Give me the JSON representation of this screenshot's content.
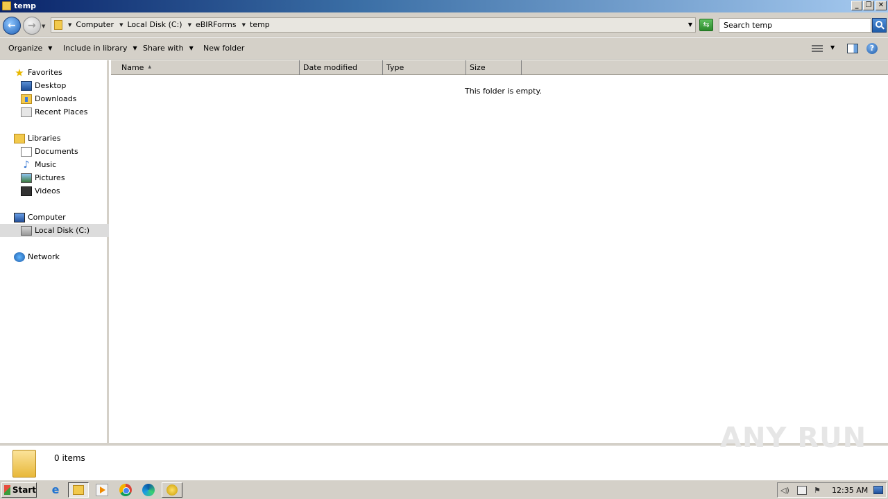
{
  "window": {
    "title": "temp"
  },
  "address": {
    "crumbs": [
      "Computer",
      "Local Disk (C:)",
      "eBIRForms",
      "temp"
    ]
  },
  "search": {
    "placeholder": "Search temp"
  },
  "toolbar": {
    "organize": "Organize",
    "include_in_library": "Include in library",
    "share_with": "Share with",
    "new_folder": "New folder"
  },
  "nav": {
    "favorites": "Favorites",
    "desktop": "Desktop",
    "downloads": "Downloads",
    "recent_places": "Recent Places",
    "libraries": "Libraries",
    "documents": "Documents",
    "music": "Music",
    "pictures": "Pictures",
    "videos": "Videos",
    "computer": "Computer",
    "local_disk": "Local Disk (C:)",
    "network": "Network"
  },
  "columns": {
    "name": "Name",
    "date_modified": "Date modified",
    "type": "Type",
    "size": "Size"
  },
  "content": {
    "empty_message": "This folder is empty."
  },
  "details": {
    "items_count": "0 items"
  },
  "watermark": "ANY RUN",
  "taskbar": {
    "start": "Start",
    "clock": "12:35 AM"
  },
  "icons": [
    "folder-icon",
    "back-arrow-icon",
    "forward-arrow-icon",
    "refresh-icon",
    "search-icon",
    "view-options-icon",
    "preview-pane-icon",
    "help-icon",
    "star-icon",
    "desktop-icon",
    "downloads-icon",
    "recent-places-icon",
    "libraries-icon",
    "documents-icon",
    "music-icon",
    "pictures-icon",
    "videos-icon",
    "computer-icon",
    "local-disk-icon",
    "network-icon",
    "ie-icon",
    "media-player-icon",
    "chrome-icon",
    "edge-icon",
    "volume-icon",
    "network-tray-icon",
    "action-center-icon",
    "show-desktop-icon"
  ],
  "colors": {
    "title_gradient_start": "#0a246a",
    "window_chrome": "#d4d0c8",
    "selection": "#dcdcdc"
  }
}
